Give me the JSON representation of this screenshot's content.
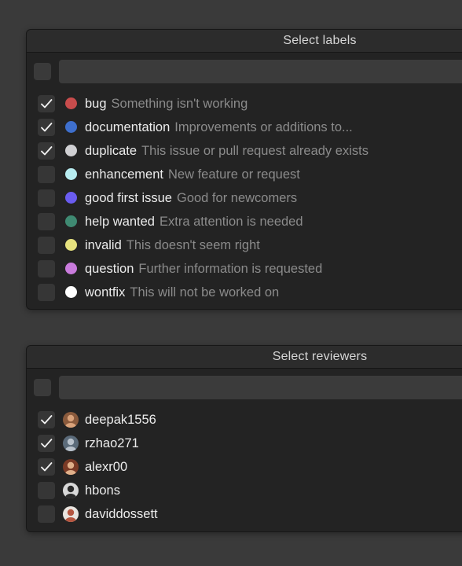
{
  "labels_panel": {
    "title": "Select labels",
    "filter": {
      "value": "",
      "placeholder": ""
    },
    "items": [
      {
        "name": "bug",
        "description": "Something isn't working",
        "color": "#c84c4c",
        "checked": true
      },
      {
        "name": "documentation",
        "description": "Improvements or additions to...",
        "color": "#3e6fcd",
        "checked": true
      },
      {
        "name": "duplicate",
        "description": "This issue or pull request already exists",
        "color": "#d0d0d3",
        "checked": true
      },
      {
        "name": "enhancement",
        "description": "New feature or request",
        "color": "#b7ecf0",
        "checked": false
      },
      {
        "name": "good first issue",
        "description": "Good for newcomers",
        "color": "#6a5cf0",
        "checked": false
      },
      {
        "name": "help wanted",
        "description": "Extra attention is needed",
        "color": "#3f8a72",
        "checked": false
      },
      {
        "name": "invalid",
        "description": "This doesn't seem right",
        "color": "#e6e27e",
        "checked": false
      },
      {
        "name": "question",
        "description": "Further information is requested",
        "color": "#c97bdc",
        "checked": false
      },
      {
        "name": "wontfix",
        "description": "This will not be worked on",
        "color": "#ffffff",
        "checked": false
      }
    ]
  },
  "reviewers_panel": {
    "title": "Select reviewers",
    "filter": {
      "value": "",
      "placeholder": ""
    },
    "items": [
      {
        "name": "deepak1556",
        "checked": true,
        "avatar_colors": [
          "#8a5a3c",
          "#d9a27a"
        ]
      },
      {
        "name": "rzhao271",
        "checked": true,
        "avatar_colors": [
          "#5b6b7a",
          "#b9c2cc"
        ]
      },
      {
        "name": "alexr00",
        "checked": true,
        "avatar_colors": [
          "#7a3a26",
          "#e0b08a"
        ]
      },
      {
        "name": "hbons",
        "checked": false,
        "avatar_colors": [
          "#d8d8d8",
          "#2a2a2a"
        ]
      },
      {
        "name": "daviddossett",
        "checked": false,
        "avatar_colors": [
          "#e9e4df",
          "#b5553f"
        ]
      }
    ]
  }
}
